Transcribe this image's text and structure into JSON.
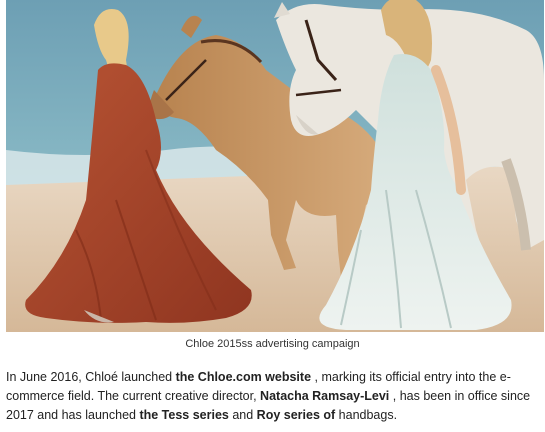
{
  "figure": {
    "alt": "",
    "caption": "Chloe 2015ss advertising campaign"
  },
  "article": {
    "paragraph": {
      "t1": "In June 2016, Chloé launched ",
      "b1": "the Chloe.com website",
      "t2": " , marking its official entry into the e-commerce field. The current creative director, ",
      "b2": "Natacha Ramsay-Levi",
      "t3": " , has been in office since 2017 and has launched ",
      "b3": "the Tess series",
      "t4": " and ",
      "b4": "Roy series of",
      "t5": " handbags."
    }
  },
  "colors": {
    "sea": "#6fa7b8",
    "sky": "#9ec6d3",
    "sand": "#e2cdb6",
    "rust_dress": "#a8452a",
    "pale_dress": "#d9e6e3",
    "palomino": "#c99a68",
    "white_horse": "#ece9e3"
  }
}
